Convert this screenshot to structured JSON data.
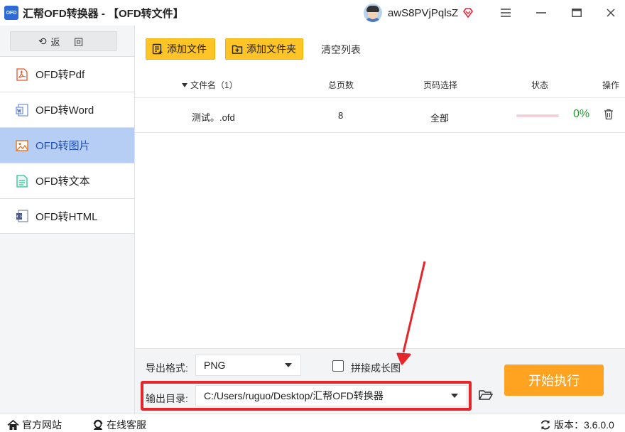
{
  "window": {
    "logo_text": "OFD",
    "title": "汇帮OFD转换器 - 【OFD转文件】",
    "username": "awS8PVjPqlsZ"
  },
  "sidebar": {
    "back_label": "返 回",
    "items": [
      {
        "label": "OFD转Pdf",
        "icon": "pdf-icon",
        "active": false
      },
      {
        "label": "OFD转Word",
        "icon": "word-icon",
        "active": false
      },
      {
        "label": "OFD转图片",
        "icon": "image-icon",
        "active": true
      },
      {
        "label": "OFD转文本",
        "icon": "text-file-icon",
        "active": false
      },
      {
        "label": "OFD转HTML",
        "icon": "html-icon",
        "active": false
      }
    ]
  },
  "toolbar": {
    "add_file": "添加文件",
    "add_folder": "添加文件夹",
    "clear_list": "清空列表"
  },
  "table": {
    "headers": {
      "filename": "文件名（1）",
      "pages": "总页数",
      "page_select": "页码选择",
      "status": "状态",
      "action": "操作"
    },
    "rows": [
      {
        "filename": "测试。.ofd",
        "pages": "8",
        "page_select": "全部",
        "progress": 0,
        "progress_text": "0%"
      }
    ]
  },
  "settings": {
    "format_label": "导出格式:",
    "format_value": "PNG",
    "merge_label": "拼接成长图",
    "merge_checked": false,
    "output_label": "输出目录:",
    "output_value": "C:/Users/ruguo/Desktop/汇帮OFD转换器",
    "start_label": "开始执行"
  },
  "footer": {
    "website": "官方网站",
    "support": "在线客服",
    "version_label": "版本：",
    "version": "3.6.0.0"
  },
  "colors": {
    "accent_yellow": "#ffc425",
    "start_orange": "#ffa320",
    "active_nav": "#b6cef4",
    "highlight_red": "#e5262a",
    "progress_green": "#2b9a34"
  }
}
